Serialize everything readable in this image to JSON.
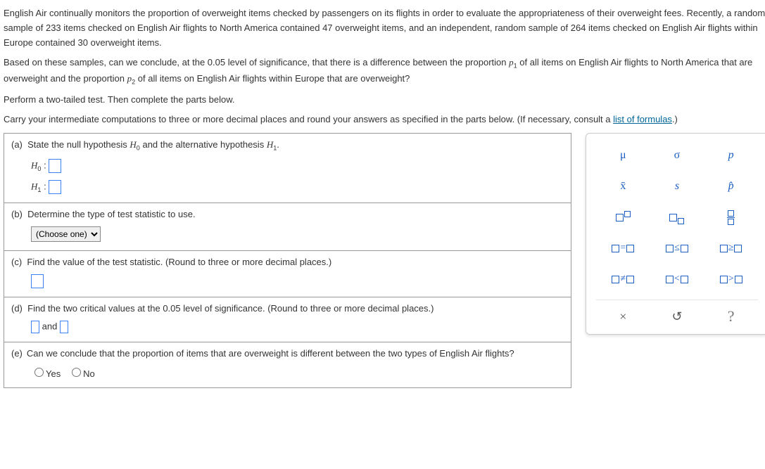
{
  "intro": {
    "p1": "English Air continually monitors the proportion of overweight items checked by passengers on its flights in order to evaluate the appropriateness of their overweight fees. Recently, a random sample of 233 items checked on English Air flights to North America contained 47 overweight items, and an independent, random sample of 264 items checked on English Air flights within Europe contained 30 overweight items.",
    "p2a": "Based on these samples, can we conclude, at the 0.05 level of significance, that there is a difference between the proportion ",
    "p2b": " of all items on English Air flights to North America that are overweight and the proportion ",
    "p2c": " of all items on English Air flights within Europe that are overweight?",
    "p3": "Perform a two-tailed test. Then complete the parts below.",
    "p4a": "Carry your intermediate computations to three or more decimal places and round your answers as specified in the parts below. (If necessary, consult a ",
    "formulas_link": "list of formulas",
    "p4b": ".)"
  },
  "parts": {
    "a": {
      "label": "(a)",
      "text": "State the null hypothesis ",
      "text2": " and the alternative hypothesis ",
      "text3": ".",
      "h0": "H",
      "h0sub": "0",
      "h1": "H",
      "h1sub": "1",
      "colon": " :"
    },
    "b": {
      "label": "(b)",
      "text": "Determine the type of test statistic to use.",
      "choose": "(Choose one)"
    },
    "c": {
      "label": "(c)",
      "text": "Find the value of the test statistic. (Round to three or more decimal places.)"
    },
    "d": {
      "label": "(d)",
      "text": "Find the two critical values at the 0.05 level of significance. (Round to three or more decimal places.)",
      "and": " and "
    },
    "e": {
      "label": "(e)",
      "text": "Can we conclude that the proportion of items that are overweight is different between the two types of English Air flights?",
      "yes": "Yes",
      "no": "No"
    }
  },
  "palette": {
    "r1": [
      "μ",
      "σ",
      "p"
    ],
    "r2": [
      "x̄",
      "s",
      "p̂"
    ],
    "bottom": {
      "close": "×",
      "reset": "↺",
      "help": "?"
    }
  }
}
